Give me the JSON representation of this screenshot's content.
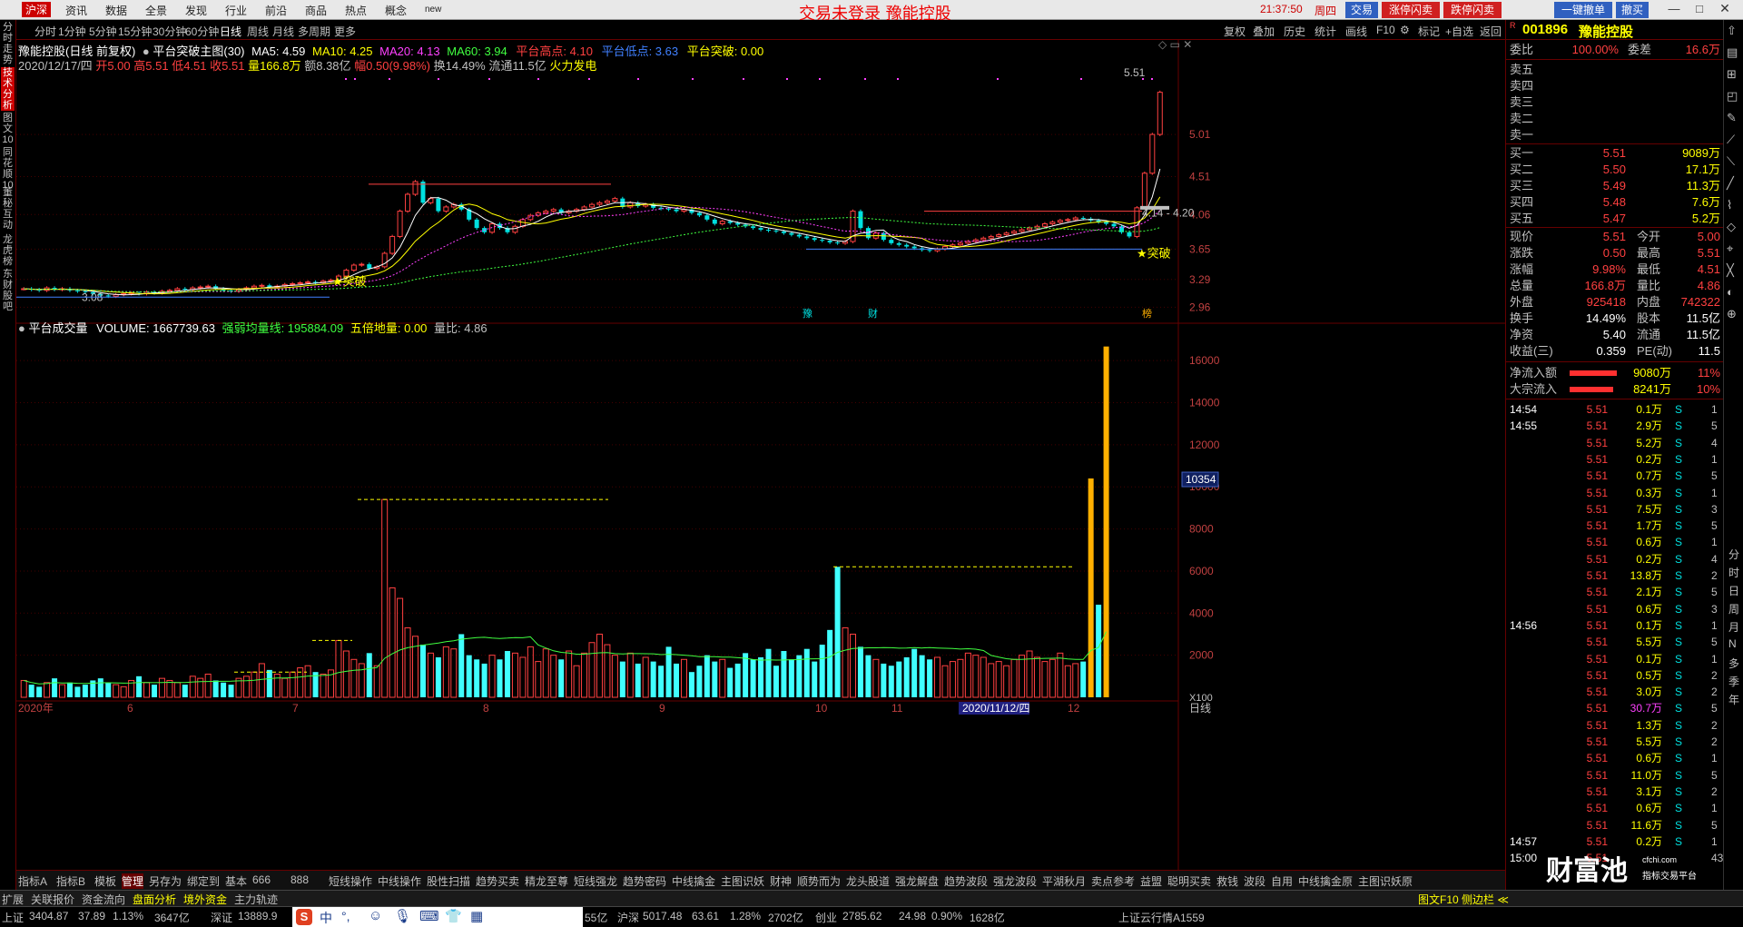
{
  "topbar": {
    "menu": [
      "沪深",
      "资讯",
      "数据",
      "全景",
      "发现",
      "行业",
      "前沿",
      "商品",
      "热点",
      "概念",
      "new"
    ],
    "banner": "交易未登录   豫能控股",
    "clock": "21:37:50",
    "weekday": "周四",
    "buttons": [
      "交易",
      "涨停闪卖",
      "跌停闪卖",
      "一键撤单",
      "撤买"
    ]
  },
  "periods": [
    "分时",
    "1分钟",
    "5分钟",
    "15分钟",
    "30分钟",
    "60分钟",
    "日线",
    "周线",
    "月线",
    "多周期",
    "更多"
  ],
  "tools": [
    "复权",
    "叠加",
    "历史",
    "统计",
    "画线",
    "F10",
    "标记",
    "+自选",
    "返回"
  ],
  "left_tabs": [
    "分时走势",
    "技术分析",
    "图文10",
    "同花顺10",
    "董秘互动",
    "龙虎榜",
    "东财股吧"
  ],
  "header": {
    "title": "豫能控股(日线 前复权)",
    "indicator": "平台突破主图(30)",
    "ma5": "MA5: 4.59",
    "ma10": "MA10: 4.25",
    "ma20": "MA20: 4.13",
    "ma60": "MA60: 3.94",
    "high_label": "平台高点: 4.10",
    "low_label": "平台低点: 3.63",
    "break_label": "平台突破: 0.00",
    "date": "2020/12/17/四",
    "open": "开5.00",
    "high": "高5.51",
    "low": "低4.51",
    "close": "收5.51",
    "volume": "量166.8万",
    "amount": "额8.38亿",
    "change": "幅0.50(9.98%)",
    "turnover": "换14.49%",
    "float": "流通11.5亿",
    "concept": "火力发电"
  },
  "chart_data": {
    "type": "candlestick",
    "title": "豫能控股(日线 前复权)",
    "y_ticks": [
      "5.01",
      "4.51",
      "4.06",
      "3.65",
      "3.29",
      "2.96"
    ],
    "ylim": [
      2.9,
      5.7
    ],
    "x_labels": [
      "2020年",
      "6",
      "7",
      "8",
      "9",
      "10",
      "11",
      "2020/11/12/四",
      "12"
    ],
    "annotations": [
      "5.51",
      "3.08",
      "4.14 - 4.20",
      "突破",
      "突破",
      "豫",
      "财",
      "榜"
    ],
    "close": [
      3.18,
      3.17,
      3.16,
      3.19,
      3.17,
      3.18,
      3.16,
      3.15,
      3.14,
      3.12,
      3.1,
      3.09,
      3.11,
      3.12,
      3.13,
      3.12,
      3.14,
      3.13,
      3.15,
      3.16,
      3.18,
      3.17,
      3.19,
      3.2,
      3.21,
      3.18,
      3.16,
      3.15,
      3.17,
      3.19,
      3.21,
      3.22,
      3.2,
      3.21,
      3.23,
      3.24,
      3.25,
      3.26,
      3.25,
      3.27,
      3.28,
      3.33,
      3.4,
      3.46,
      3.47,
      3.42,
      3.44,
      3.6,
      3.8,
      4.1,
      4.3,
      4.45,
      4.2,
      4.25,
      4.1,
      4.15,
      4.18,
      4.12,
      4.0,
      3.9,
      3.85,
      3.95,
      3.9,
      3.85,
      3.92,
      4.0,
      4.05,
      4.08,
      4.1,
      4.12,
      4.08,
      4.1,
      4.12,
      4.15,
      4.18,
      4.2,
      4.22,
      4.25,
      4.15,
      4.2,
      4.16,
      4.18,
      4.14,
      4.13,
      4.12,
      4.1,
      4.12,
      4.08,
      4.05,
      4.0,
      3.95,
      3.98,
      3.96,
      3.94,
      3.92,
      3.9,
      3.88,
      3.87,
      3.86,
      3.84,
      3.82,
      3.8,
      3.78,
      3.76,
      3.75,
      3.73,
      3.72,
      3.74,
      4.1,
      3.9,
      3.78,
      3.84,
      3.76,
      3.72,
      3.7,
      3.68,
      3.66,
      3.64,
      3.63,
      3.65,
      3.68,
      3.7,
      3.72,
      3.74,
      3.76,
      3.78,
      3.8,
      3.82,
      3.84,
      3.86,
      3.88,
      3.9,
      3.92,
      3.95,
      3.97,
      3.99,
      4.0,
      4.02,
      4.01,
      3.99,
      3.97,
      3.95,
      3.92,
      3.85,
      3.8,
      4.14,
      4.55,
      5.01,
      5.51
    ],
    "volume_unit": "手 x100",
    "volume_y_ticks": [
      "16000",
      "14000",
      "12000",
      "10000",
      "8000",
      "6000",
      "4000",
      "2000"
    ],
    "volume_ylim": [
      0,
      17000
    ],
    "volume_value_label": "10354",
    "volume_multiplier_label": "X100",
    "volume_label": "VOLUME: 1667739.63",
    "volume_ma_label": "强弱均量线: 195884.09",
    "volume_five": "五倍地量: 0.00",
    "volume_ratio": "量比: 4.86",
    "volume_indicator": "平台成交量",
    "volume": [
      80,
      60,
      50,
      70,
      90,
      60,
      70,
      50,
      60,
      80,
      90,
      70,
      60,
      50,
      80,
      100,
      70,
      60,
      90,
      80,
      70,
      60,
      100,
      90,
      110,
      80,
      70,
      60,
      90,
      100,
      120,
      160,
      130,
      110,
      90,
      120,
      140,
      150,
      120,
      110,
      130,
      270,
      220,
      180,
      160,
      210,
      150,
      940,
      520,
      470,
      330,
      290,
      250,
      210,
      190,
      240,
      230,
      300,
      200,
      180,
      160,
      200,
      180,
      220,
      210,
      190,
      240,
      170,
      230,
      200,
      180,
      220,
      150,
      210,
      260,
      300,
      250,
      200,
      170,
      210,
      160,
      190,
      170,
      150,
      240,
      160,
      180,
      120,
      150,
      200,
      170,
      180,
      140,
      160,
      210,
      180,
      190,
      230,
      150,
      220,
      180,
      200,
      230,
      170,
      250,
      320,
      620,
      330,
      300,
      240,
      200,
      180,
      160,
      150,
      170,
      190,
      230,
      200,
      180,
      190,
      150,
      170,
      180,
      210,
      200,
      190,
      160,
      170,
      150,
      180,
      200,
      220,
      190,
      170,
      180,
      210,
      150,
      160,
      170,
      1040,
      440,
      1667
    ],
    "volume_colors": "red-up cyan-down"
  },
  "quote": {
    "code": "001896",
    "name": "豫能控股",
    "weibi_label": "委比",
    "weibi": "100.00%",
    "weicha_label": "委差",
    "weicha": "16.6万",
    "sell": [
      {
        "label": "卖五",
        "price": "",
        "vol": ""
      },
      {
        "label": "卖四",
        "price": "",
        "vol": ""
      },
      {
        "label": "卖三",
        "price": "",
        "vol": ""
      },
      {
        "label": "卖二",
        "price": "",
        "vol": ""
      },
      {
        "label": "卖一",
        "price": "",
        "vol": ""
      }
    ],
    "buy": [
      {
        "label": "买一",
        "price": "5.51",
        "vol": "9089万"
      },
      {
        "label": "买二",
        "price": "5.50",
        "vol": "17.1万"
      },
      {
        "label": "买三",
        "price": "5.49",
        "vol": "11.3万"
      },
      {
        "label": "买四",
        "price": "5.48",
        "vol": "7.6万"
      },
      {
        "label": "买五",
        "price": "5.47",
        "vol": "5.2万"
      }
    ],
    "stats": [
      {
        "l": "现价",
        "m": "5.51",
        "rl": "今开",
        "r": "5.00"
      },
      {
        "l": "涨跌",
        "m": "0.50",
        "rl": "最高",
        "r": "5.51"
      },
      {
        "l": "涨幅",
        "m": "9.98%",
        "rl": "最低",
        "r": "4.51"
      },
      {
        "l": "总量",
        "m": "166.8万",
        "rl": "量比",
        "r": "4.86"
      },
      {
        "l": "外盘",
        "m": "925418",
        "rl": "内盘",
        "r": "742322"
      },
      {
        "l": "换手",
        "m": "14.49%",
        "rl": "股本",
        "r": "11.5亿"
      },
      {
        "l": "净资",
        "m": "5.40",
        "rl": "流通",
        "r": "11.5亿"
      },
      {
        "l": "收益(三)",
        "m": "0.359",
        "rl": "PE(动)",
        "r": "11.5"
      }
    ],
    "flows": [
      {
        "l": "净流入额",
        "v": "9080万",
        "p": "11%"
      },
      {
        "l": "大宗流入",
        "v": "8241万",
        "p": "10%"
      }
    ]
  },
  "ticks": [
    {
      "t": "14:54",
      "p": "5.51",
      "v": "0.1万",
      "s": "S",
      "n": "1"
    },
    {
      "t": "14:55",
      "p": "5.51",
      "v": "2.9万",
      "s": "S",
      "n": "5"
    },
    {
      "t": "",
      "p": "5.51",
      "v": "5.2万",
      "s": "S",
      "n": "4"
    },
    {
      "t": "",
      "p": "5.51",
      "v": "0.2万",
      "s": "S",
      "n": "1"
    },
    {
      "t": "",
      "p": "5.51",
      "v": "0.7万",
      "s": "S",
      "n": "5"
    },
    {
      "t": "",
      "p": "5.51",
      "v": "0.3万",
      "s": "S",
      "n": "1"
    },
    {
      "t": "",
      "p": "5.51",
      "v": "7.5万",
      "s": "S",
      "n": "3"
    },
    {
      "t": "",
      "p": "5.51",
      "v": "1.7万",
      "s": "S",
      "n": "5"
    },
    {
      "t": "",
      "p": "5.51",
      "v": "0.6万",
      "s": "S",
      "n": "1"
    },
    {
      "t": "",
      "p": "5.51",
      "v": "0.2万",
      "s": "S",
      "n": "4"
    },
    {
      "t": "",
      "p": "5.51",
      "v": "13.8万",
      "s": "S",
      "n": "2"
    },
    {
      "t": "",
      "p": "5.51",
      "v": "2.1万",
      "s": "S",
      "n": "5"
    },
    {
      "t": "",
      "p": "5.51",
      "v": "0.6万",
      "s": "S",
      "n": "3"
    },
    {
      "t": "14:56",
      "p": "5.51",
      "v": "0.1万",
      "s": "S",
      "n": "1"
    },
    {
      "t": "",
      "p": "5.51",
      "v": "5.5万",
      "s": "S",
      "n": "5"
    },
    {
      "t": "",
      "p": "5.51",
      "v": "0.1万",
      "s": "S",
      "n": "1"
    },
    {
      "t": "",
      "p": "5.51",
      "v": "0.5万",
      "s": "S",
      "n": "2"
    },
    {
      "t": "",
      "p": "5.51",
      "v": "3.0万",
      "s": "S",
      "n": "2"
    },
    {
      "t": "",
      "p": "5.51",
      "v": "30.7万",
      "s": "S",
      "n": "5"
    },
    {
      "t": "",
      "p": "5.51",
      "v": "1.3万",
      "s": "S",
      "n": "2"
    },
    {
      "t": "",
      "p": "5.51",
      "v": "5.5万",
      "s": "S",
      "n": "2"
    },
    {
      "t": "",
      "p": "5.51",
      "v": "0.6万",
      "s": "S",
      "n": "1"
    },
    {
      "t": "",
      "p": "5.51",
      "v": "11.0万",
      "s": "S",
      "n": "5"
    },
    {
      "t": "",
      "p": "5.51",
      "v": "3.1万",
      "s": "S",
      "n": "2"
    },
    {
      "t": "",
      "p": "5.51",
      "v": "0.6万",
      "s": "S",
      "n": "1"
    },
    {
      "t": "",
      "p": "5.51",
      "v": "11.6万",
      "s": "S",
      "n": "5"
    },
    {
      "t": "14:57",
      "p": "5.51",
      "v": "0.2万",
      "s": "S",
      "n": "1"
    },
    {
      "t": "15:00",
      "p": "5.51",
      "v": "",
      "s": "",
      "n": "43"
    }
  ],
  "right_edge": [
    "分",
    "时",
    "日",
    "周",
    "月",
    "N",
    "多",
    "季",
    "年"
  ],
  "bottom_tabs1": [
    "指标A",
    "指标B",
    "模板",
    "管理",
    "另存为",
    "绑定到",
    "基本",
    "666",
    "888",
    "短线操作",
    "中线操作",
    "股性扫描",
    "趋势买卖",
    "精龙至尊",
    "短线强龙",
    "趋势密码",
    "中线擒金",
    "主图识妖",
    "财神",
    "顺势而为",
    "龙头股道",
    "强龙解盘",
    "趋势波段",
    "强龙波段",
    "平湖秋月",
    "卖点参考",
    "益盟",
    "聪明买卖",
    "救钱",
    "波段",
    "自用",
    "中线擒金原",
    "主图识妖原"
  ],
  "bottom_tabs2": [
    "扩展",
    "关联报价",
    "资金流向",
    "盘面分析",
    "境外资金",
    "主力轨迹"
  ],
  "status": {
    "sh_label": "上证",
    "sh": "3404.87",
    "sh_chg": "37.89",
    "sh_pct": "1.13%",
    "sh_amt": "3647亿",
    "sz_label": "深证",
    "sz": "13889.9",
    "hs_amt": "55亿",
    "hs_label": "沪深",
    "hs": "5017.48",
    "hs_chg": "63.61",
    "hs_pct": "1.28%",
    "hs_amt2": "2702亿",
    "cy_label": "创业",
    "cy": "2785.62",
    "cy_chg": "24.98",
    "cy_pct": "0.90%",
    "cy_amt": "1628亿",
    "cloud": "上证云行情A1559",
    "f10": "图文F10 侧边栏 ≪",
    "brand": "财富池",
    "brand_sub": "指标交易平台",
    "brand_url": "cfchi.com"
  }
}
